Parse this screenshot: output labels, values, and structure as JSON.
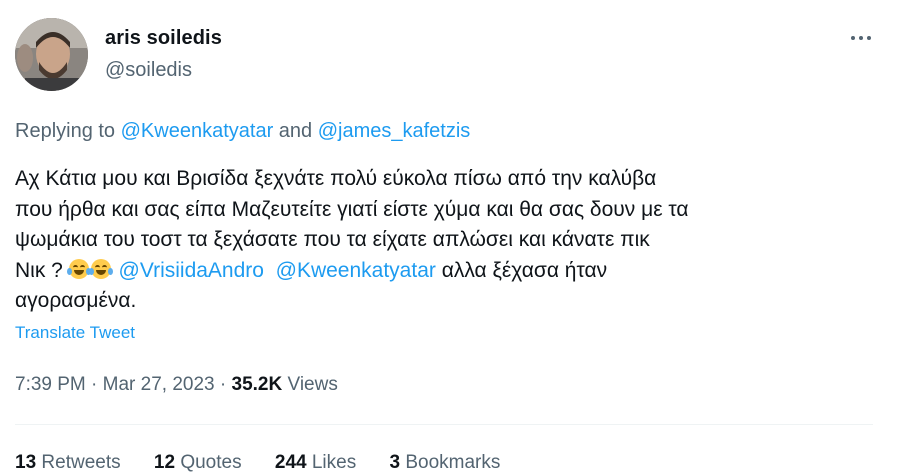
{
  "author": {
    "name": "aris soiledis",
    "handle": "@soiledis"
  },
  "replying": {
    "prefix": "Replying to ",
    "user1": "@Kweenkatyatar",
    "conj": " and ",
    "user2": "@james_kafetzis"
  },
  "tweet": {
    "line1": "Αχ Κάτια μου και Βρισίδα ξεχνάτε πολύ εύκολα πίσω από την καλύβα",
    "line2": "που ήρθα και σας είπα Μαζευτείτε γιατί είστε χύμα και θα σας δουν με τα",
    "line3": "ψωμάκια του τοστ  τα ξεχάσατε  που τα είχατε απλώσει και κάνατε πικ",
    "line4_start": "Νικ ? ",
    "mention1": "@VrisiidaAndro",
    "mention2": "@Kweenkatyatar",
    "line4_end": "  αλλα ξέχασα ήταν",
    "line5": "αγορασμένα.",
    "emoji": "face-with-tears-of-joy"
  },
  "translate_label": "Translate Tweet",
  "meta": {
    "time": "7:39 PM",
    "sep1": " · ",
    "date": "Mar 27, 2023",
    "sep2": " · ",
    "views_count": "35.2K",
    "views_label": " Views"
  },
  "stats": {
    "retweets_count": "13",
    "retweets_label": " Retweets",
    "quotes_count": "12",
    "quotes_label": " Quotes",
    "likes_count": "244",
    "likes_label": " Likes",
    "bookmarks_count": "3",
    "bookmarks_label": " Bookmarks"
  },
  "colors": {
    "link": "#1d9bf0",
    "secondary": "#536471",
    "text": "#0f1419"
  }
}
